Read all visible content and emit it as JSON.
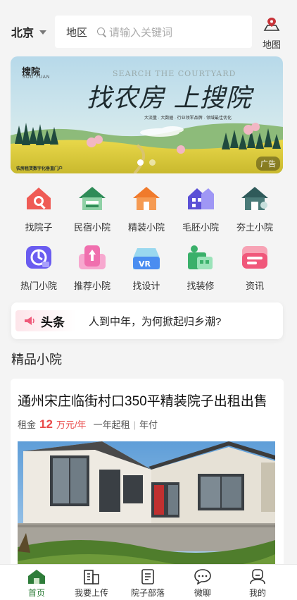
{
  "header": {
    "city": "北京",
    "search_region": "地区",
    "search_placeholder": "请输入关键词",
    "map_label": "地图"
  },
  "banner": {
    "brand": "搜院",
    "brand_sub": "SOU YUAN",
    "english_title": "SEARCH THE COURTYARD",
    "slogan": "找农房 上搜院",
    "tagline": "大流量 · 大数据 · 行业领军品牌 · 领域最佳优化",
    "footnote": "农房租赁数字化垂直门户",
    "ad_label": "广告",
    "slide_count": 2,
    "active_slide": 1
  },
  "categories": [
    {
      "label": "找院子",
      "icon": "house-search-icon",
      "color": "#e84a4a"
    },
    {
      "label": "民宿小院",
      "icon": "homestay-icon",
      "color": "#2e8b57"
    },
    {
      "label": "精装小院",
      "icon": "fine-house-icon",
      "color": "#f07a2c"
    },
    {
      "label": "毛胚小院",
      "icon": "raw-house-icon",
      "color": "#5b50d6"
    },
    {
      "label": "夯土小院",
      "icon": "earth-house-icon",
      "color": "#2f5a5a"
    },
    {
      "label": "热门小院",
      "icon": "hot-courtyard-icon",
      "color": "#6a5cf0"
    },
    {
      "label": "推荐小院",
      "icon": "recommend-icon",
      "color": "#f06fae"
    },
    {
      "label": "找设计",
      "icon": "vr-design-icon",
      "color": "#4a8df0"
    },
    {
      "label": "找装修",
      "icon": "renovation-icon",
      "color": "#3ab06a"
    },
    {
      "label": "资讯",
      "icon": "news-icon",
      "color": "#f0577a"
    }
  ],
  "headline": {
    "tag": "头条",
    "text": "人到中年，为何掀起归乡潮?"
  },
  "section": {
    "title": "精品小院"
  },
  "listing": {
    "title": "通州宋庄临街村口350平精装院子出租出售",
    "rent_label": "租金",
    "price": "12",
    "unit": "万元/年",
    "term": "一年起租",
    "separator": "|",
    "payment": "年付"
  },
  "bottom_nav": [
    {
      "label": "首页",
      "icon": "home-icon",
      "active": true
    },
    {
      "label": "我要上传",
      "icon": "building-upload-icon",
      "active": false
    },
    {
      "label": "院子部落",
      "icon": "document-icon",
      "active": false
    },
    {
      "label": "微聊",
      "icon": "chat-icon",
      "active": false
    },
    {
      "label": "我的",
      "icon": "user-icon",
      "active": false
    }
  ],
  "colors": {
    "accent_green": "#2f7d3a",
    "price_red": "#e94b4b",
    "map_pin_red": "#c8343a"
  }
}
